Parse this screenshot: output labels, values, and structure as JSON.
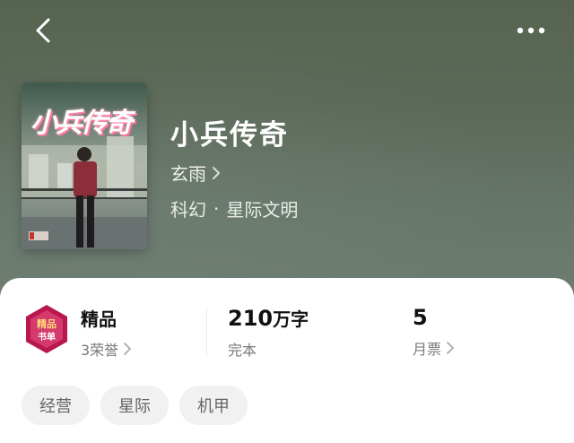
{
  "header": {
    "back_icon": "chevron-left-icon",
    "more_icon": "more-dots-icon"
  },
  "book": {
    "cover_title": "小兵传奇",
    "title": "小兵传奇",
    "author": "玄雨",
    "category": "科幻",
    "separator": "·",
    "subcategory": "星际文明"
  },
  "stats": {
    "quality": {
      "label": "精品",
      "sub": "3荣誉"
    },
    "words": {
      "number": "210",
      "unit": "万字",
      "sub": "完本"
    },
    "votes": {
      "number": "5",
      "sub": "月票"
    }
  },
  "tags": [
    "经营",
    "星际",
    "机甲"
  ],
  "colors": {
    "hero_bg": "#5b6959",
    "panel_bg": "#ffffff",
    "tag_bg": "#f1f1f1",
    "badge_accent": "#c2185b"
  }
}
